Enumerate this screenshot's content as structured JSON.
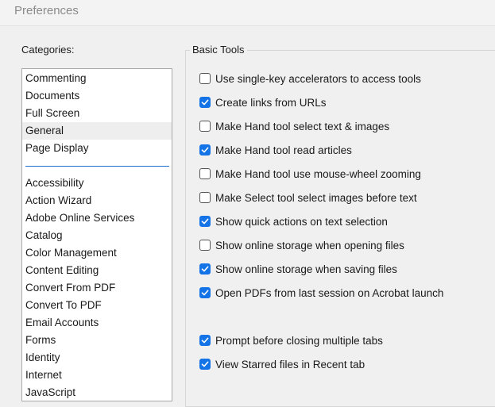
{
  "window": {
    "title": "Preferences"
  },
  "categories": {
    "label": "Categories:",
    "top_items": [
      {
        "label": "Commenting",
        "selected": false
      },
      {
        "label": "Documents",
        "selected": false
      },
      {
        "label": "Full Screen",
        "selected": false
      },
      {
        "label": "General",
        "selected": true
      },
      {
        "label": "Page Display",
        "selected": false
      }
    ],
    "items": [
      "Accessibility",
      "Action Wizard",
      "Adobe Online Services",
      "Catalog",
      "Color Management",
      "Content Editing",
      "Convert From PDF",
      "Convert To PDF",
      "Email Accounts",
      "Forms",
      "Identity",
      "Internet",
      "JavaScript"
    ]
  },
  "basic_tools": {
    "label": "Basic Tools",
    "options": [
      {
        "label": "Use single-key accelerators to access tools",
        "checked": false
      },
      {
        "label": "Create links from URLs",
        "checked": true
      },
      {
        "label": "Make Hand tool select text & images",
        "checked": false
      },
      {
        "label": "Make Hand tool read articles",
        "checked": true
      },
      {
        "label": "Make Hand tool use mouse-wheel zooming",
        "checked": false
      },
      {
        "label": "Make Select tool select images before text",
        "checked": false
      },
      {
        "label": "Show quick actions on text selection",
        "checked": true
      },
      {
        "label": "Show online storage when opening files",
        "checked": false
      },
      {
        "label": "Show online storage when saving files",
        "checked": true
      },
      {
        "label": "Open PDFs from last session on Acrobat launch",
        "checked": true
      },
      {
        "label": "Prompt before closing multiple tabs",
        "checked": true
      },
      {
        "label": "View Starred files in Recent tab",
        "checked": true
      }
    ]
  },
  "colors": {
    "accent": "#1473e6",
    "divider": "#1a73c9"
  }
}
